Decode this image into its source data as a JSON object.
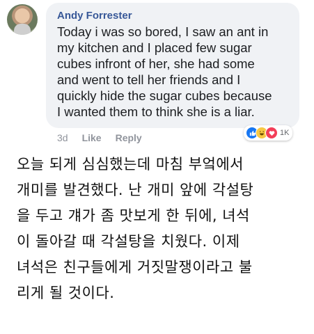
{
  "comment": {
    "author": "Andy Forrester",
    "lines": [
      "Today i was so bored, I saw an ant in",
      "my kitchen and I placed few sugar",
      "cubes infront of her, she had some",
      "and went to tell her friends and I",
      "quickly hide the sugar cubes because",
      "I wanted them to think she is a liar."
    ],
    "time": "3d",
    "like_label": "Like",
    "reply_label": "Reply",
    "reactions": {
      "icons": [
        "like-icon",
        "haha-icon",
        "love-icon"
      ],
      "count": "1K",
      "colors": {
        "like": "#1877f2",
        "haha": "#f7c844",
        "love": "#f33e58"
      }
    }
  },
  "translation": {
    "lines": [
      "오늘 되게 심심했는데 마침 부엌에서",
      "개미를 발견했다. 난 개미 앞에 각설탕",
      "을 두고 걔가 좀 맛보게 한 뒤에, 녀석",
      "이 돌아갈 때 각설탕을 치웠다. 이제",
      "녀석은 친구들에게 거짓말쟁이라고 불",
      "리게 될 것이다."
    ]
  }
}
